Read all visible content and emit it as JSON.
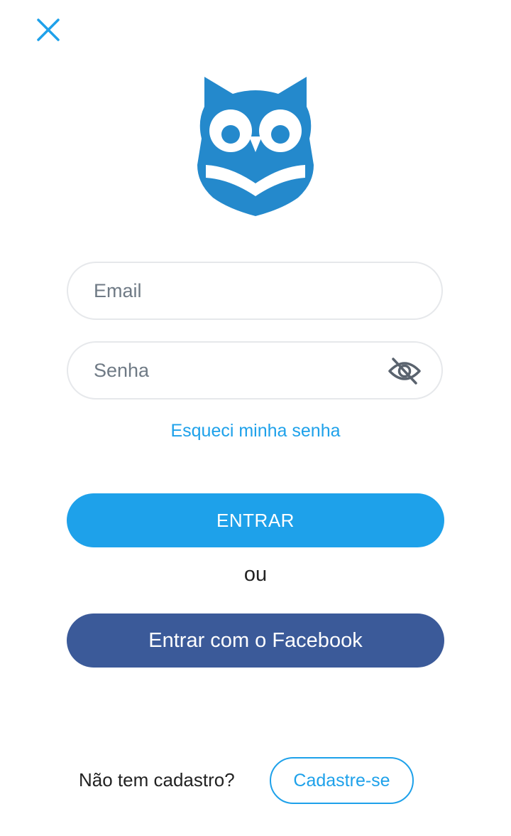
{
  "header": {
    "close_icon": "close-icon"
  },
  "logo": {
    "icon": "owl-reading-book-logo",
    "color": "#2489cc"
  },
  "form": {
    "email": {
      "placeholder": "Email",
      "value": ""
    },
    "password": {
      "placeholder": "Senha",
      "value": "",
      "toggle_icon": "eye-off-icon"
    },
    "forgot_password_label": "Esqueci minha senha",
    "login_label": "ENTRAR",
    "or_label": "ou",
    "facebook_label": "Entrar com o Facebook"
  },
  "footer": {
    "no_account_label": "Não tem cadastro?",
    "signup_label": "Cadastre-se"
  },
  "colors": {
    "accent": "#1ea1ea",
    "facebook": "#3b5a99",
    "logo": "#2489cc",
    "field_border": "#e6e8eb"
  }
}
